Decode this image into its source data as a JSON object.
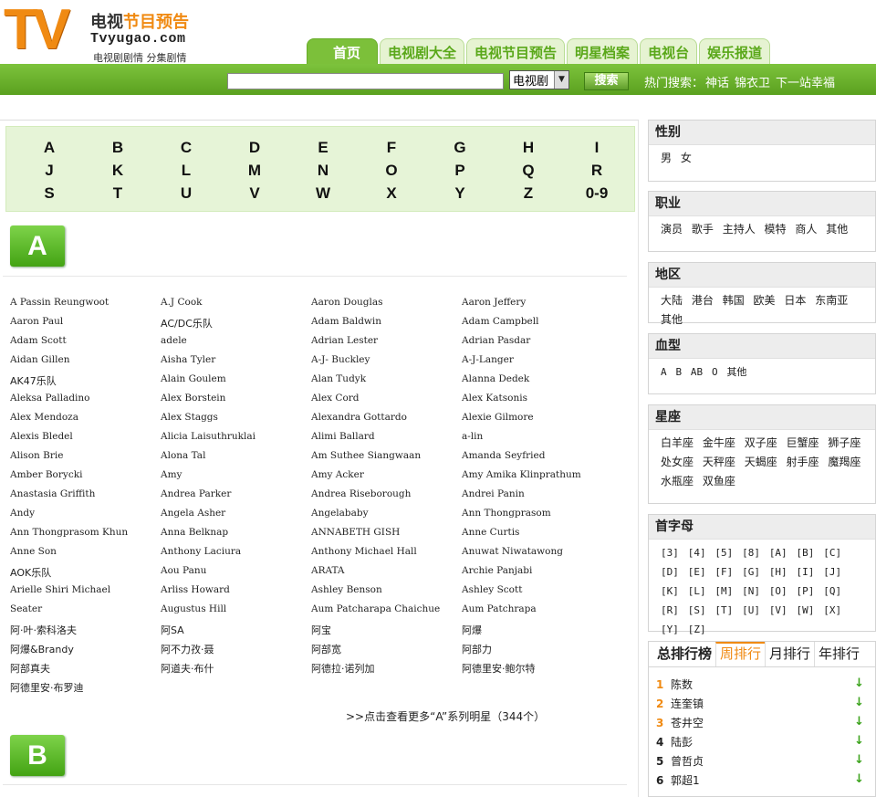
{
  "site": {
    "logo_letters": "TV",
    "name_part1": "电视",
    "name_part2": "节目预告",
    "url": "Tvyugao.com",
    "slogan": "电视剧剧情 分集剧情"
  },
  "nav": [
    {
      "label": "首页",
      "active": true
    },
    {
      "label": "电视剧大全"
    },
    {
      "label": "电视节目预告"
    },
    {
      "label": "明星档案"
    },
    {
      "label": "电视台"
    },
    {
      "label": "娱乐报道"
    }
  ],
  "search": {
    "input_value": "",
    "select_value": "电视剧",
    "button_label": "搜索",
    "hot_label": "热门搜索：",
    "hot_terms": [
      "神话",
      "锦衣卫",
      "下一站幸福"
    ]
  },
  "alphabet": [
    "A",
    "B",
    "C",
    "D",
    "E",
    "F",
    "G",
    "H",
    "I",
    "J",
    "K",
    "L",
    "M",
    "N",
    "O",
    "P",
    "Q",
    "R",
    "S",
    "T",
    "U",
    "V",
    "W",
    "X",
    "Y",
    "Z",
    "0-9"
  ],
  "section_a": {
    "letter": "A",
    "names": [
      "A Passin Reungwoot",
      "A.J Cook",
      "Aaron Douglas",
      "Aaron Jeffery",
      "Aaron Paul",
      "AC/DC乐队",
      "Adam Baldwin",
      "Adam Campbell",
      "Adam Scott",
      "adele",
      "Adrian Lester",
      "Adrian Pasdar",
      "Aidan Gillen",
      "Aisha Tyler",
      "A-J- Buckley",
      "A-J-Langer",
      "AK47乐队",
      "Alain Goulem",
      "Alan Tudyk",
      "Alanna Dedek",
      "Aleksa Palladino",
      "Alex Borstein",
      "Alex Cord",
      "Alex Katsonis",
      "Alex Mendoza",
      "Alex Staggs",
      "Alexandra Gottardo",
      "Alexie Gilmore",
      "Alexis Bledel",
      "Alicia Laisuthruklai",
      "Alimi Ballard",
      "a-lin",
      "Alison Brie",
      "Alona Tal",
      "Am Suthee Siangwaan",
      "Amanda Seyfried",
      "Amber Borycki",
      "Amy",
      "Amy Acker",
      "Amy Amika Klinprathum",
      "Anastasia Griffith",
      "Andrea Parker",
      "Andrea Riseborough",
      "Andrei Panin",
      "Andy",
      "Angela Asher",
      "Angelababy",
      "Ann Thongprasom",
      "Ann Thongprasom Khun",
      "Anna Belknap",
      "ANNABETH GISH",
      "Anne Curtis",
      "Anne Son",
      "Anthony Laciura",
      "Anthony Michael Hall",
      "Anuwat Niwatawong",
      "AOK乐队",
      "Aou Panu",
      "ARATA",
      "Archie Panjabi",
      "Arielle Shiri Michael",
      "Arliss Howard",
      "Ashley Benson",
      "Ashley Scott",
      "Seater",
      "Augustus Hill",
      "Aum Patcharapa Chaichue",
      "Aum Patchrapa",
      "阿·叶·索科洛夫",
      "阿SA",
      "阿宝",
      "阿爆",
      "阿爆&Brandy",
      "阿不力孜·聂",
      "阿部宽",
      "阿部力",
      "阿部真夫",
      "阿道夫·布什",
      "阿德拉·诺列加",
      "阿德里安·鲍尔特",
      "阿德里安·布罗迪"
    ],
    "more_link": ">>点击查看更多“A”系列明星（344个）"
  },
  "section_b": {
    "letter": "B"
  },
  "sidebar": {
    "gender": {
      "title": "性别",
      "items": [
        "男",
        "女"
      ]
    },
    "job": {
      "title": "职业",
      "items": [
        "演员",
        "歌手",
        "主持人",
        "模特",
        "商人",
        "其他"
      ]
    },
    "region": {
      "title": "地区",
      "items": [
        "大陆",
        "港台",
        "韩国",
        "欧美",
        "日本",
        "东南亚",
        "其他"
      ]
    },
    "blood": {
      "title": "血型",
      "items": [
        "A",
        "B",
        "AB",
        "O",
        "其他"
      ]
    },
    "zodiac": {
      "title": "星座",
      "items": [
        "白羊座",
        "金牛座",
        "双子座",
        "巨蟹座",
        "狮子座",
        "处女座",
        "天秤座",
        "天蝎座",
        "射手座",
        "魔羯座",
        "水瓶座",
        "双鱼座"
      ]
    },
    "initial": {
      "title": "首字母",
      "items": [
        "[3]",
        "[4]",
        "[5]",
        "[8]",
        "[A]",
        "[B]",
        "[C]",
        "[D]",
        "[E]",
        "[F]",
        "[G]",
        "[H]",
        "[I]",
        "[J]",
        "[K]",
        "[L]",
        "[M]",
        "[N]",
        "[O]",
        "[P]",
        "[Q]",
        "[R]",
        "[S]",
        "[T]",
        "[U]",
        "[V]",
        "[W]",
        "[X]",
        "[Y]",
        "[Z]"
      ]
    }
  },
  "ranking": {
    "title": "总排行榜",
    "tabs": [
      {
        "label": "周排行",
        "active": true
      },
      {
        "label": "月排行"
      },
      {
        "label": "年排行"
      }
    ],
    "rows": [
      {
        "rank": "1",
        "name": "陈数",
        "trend": "down"
      },
      {
        "rank": "2",
        "name": "连奎镇",
        "trend": "down"
      },
      {
        "rank": "3",
        "name": "苍井空",
        "trend": "down"
      },
      {
        "rank": "4",
        "name": "陆彭",
        "trend": "down"
      },
      {
        "rank": "5",
        "name": "曾哲贞",
        "trend": "down"
      },
      {
        "rank": "6",
        "name": "郭超1",
        "trend": "down"
      }
    ],
    "trend_glyph": "↓"
  },
  "colors": {
    "brand_orange": "#f08a12",
    "brand_green": "#5aa11f"
  }
}
